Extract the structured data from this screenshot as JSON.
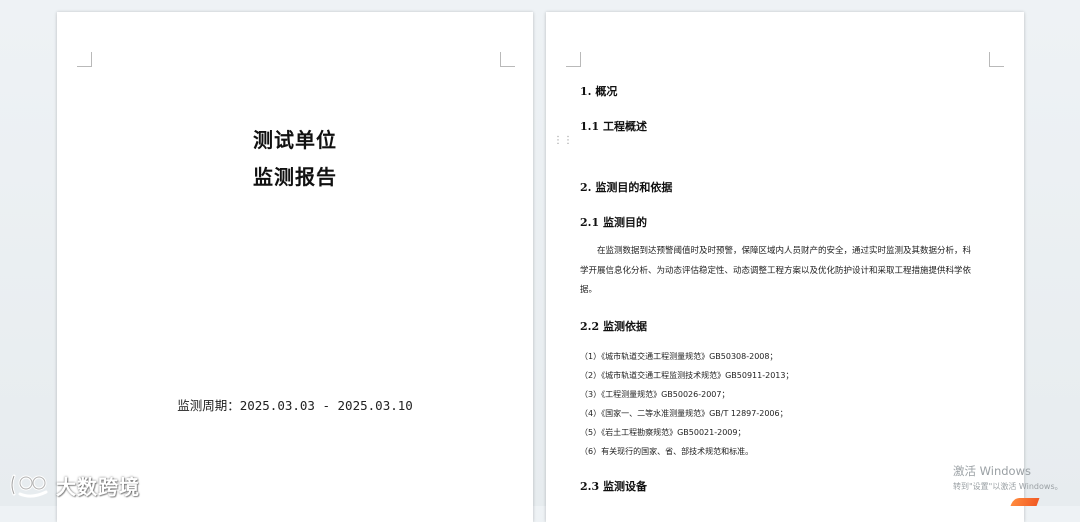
{
  "cover": {
    "title_line1": "测试单位",
    "title_line2": "监测报告",
    "period": "监测周期：2025.03.03 - 2025.03.10"
  },
  "content": {
    "h1": "1. 概况",
    "h1_1": "1.1 工程概述",
    "h2": "2. 监测目的和依据",
    "h2_1": "2.1 监测目的",
    "para_lines": [
      "在监测数据到达预警阈值时及时预警，保障区域内人员财产的安全，通过实时监测及其数据分析，科",
      "学开展信息化分析、为动态评估稳定性、动态调整工程方案以及优化防护设计和采取工程措施提供科学依",
      "据。"
    ],
    "h2_2": "2.2 监测依据",
    "references": [
      "（1）《城市轨道交通工程测量规范》GB50308-2008；",
      "（2）《城市轨道交通工程监测技术规范》GB50911-2013；",
      "（3）《工程测量规范》GB50026-2007；",
      "（4）《国家一、二等水准测量规范》GB/T 12897-2006；",
      "（5）《岩土工程勘察规范》GB50021-2009；",
      "（6）有关现行的国家、省、部技术规范和标准。"
    ],
    "h2_3": "2.3 监测设备"
  },
  "overlay": {
    "activate_title": "激活 Windows",
    "activate_sub": "转到\"设置\"以激活 Windows。",
    "brand_text": "大数跨境",
    "drag_handle_icon": "drag-handle-icon",
    "brand_logo_icon": "brand-logo-icon"
  }
}
